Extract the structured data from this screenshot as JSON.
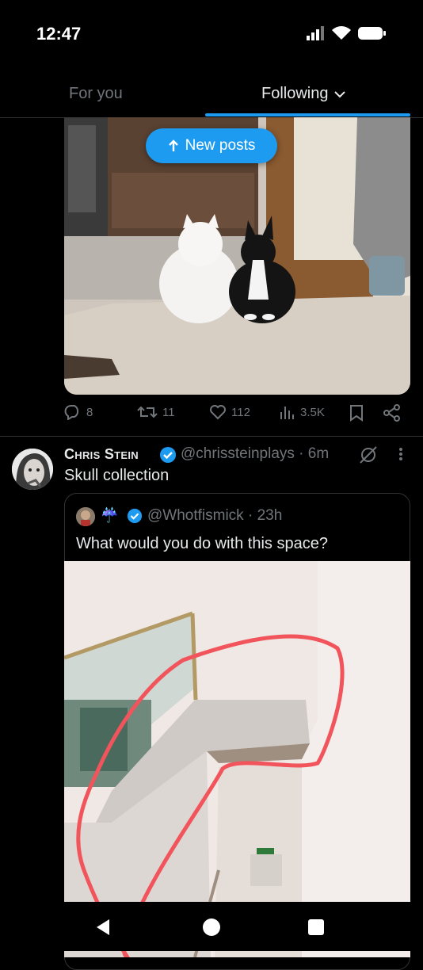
{
  "status_bar": {
    "time": "12:47"
  },
  "tabs": {
    "for_you": "For you",
    "following": "Following"
  },
  "banner": {
    "new_posts": "New posts"
  },
  "tweet1": {
    "replies": "8",
    "reposts": "11",
    "likes": "112",
    "views": "3.5K"
  },
  "tweet2": {
    "name": "Chris Stein",
    "handle_time": "@chrissteinplays · 6m",
    "text": "Skull collection",
    "quote": {
      "handle_time": "@Whotfismick · 23h",
      "text": "What would you do with this space?"
    }
  },
  "colors": {
    "accent": "#1d9bf0",
    "background": "#000000",
    "muted": "#71767b",
    "annotation": "#f2545b"
  }
}
